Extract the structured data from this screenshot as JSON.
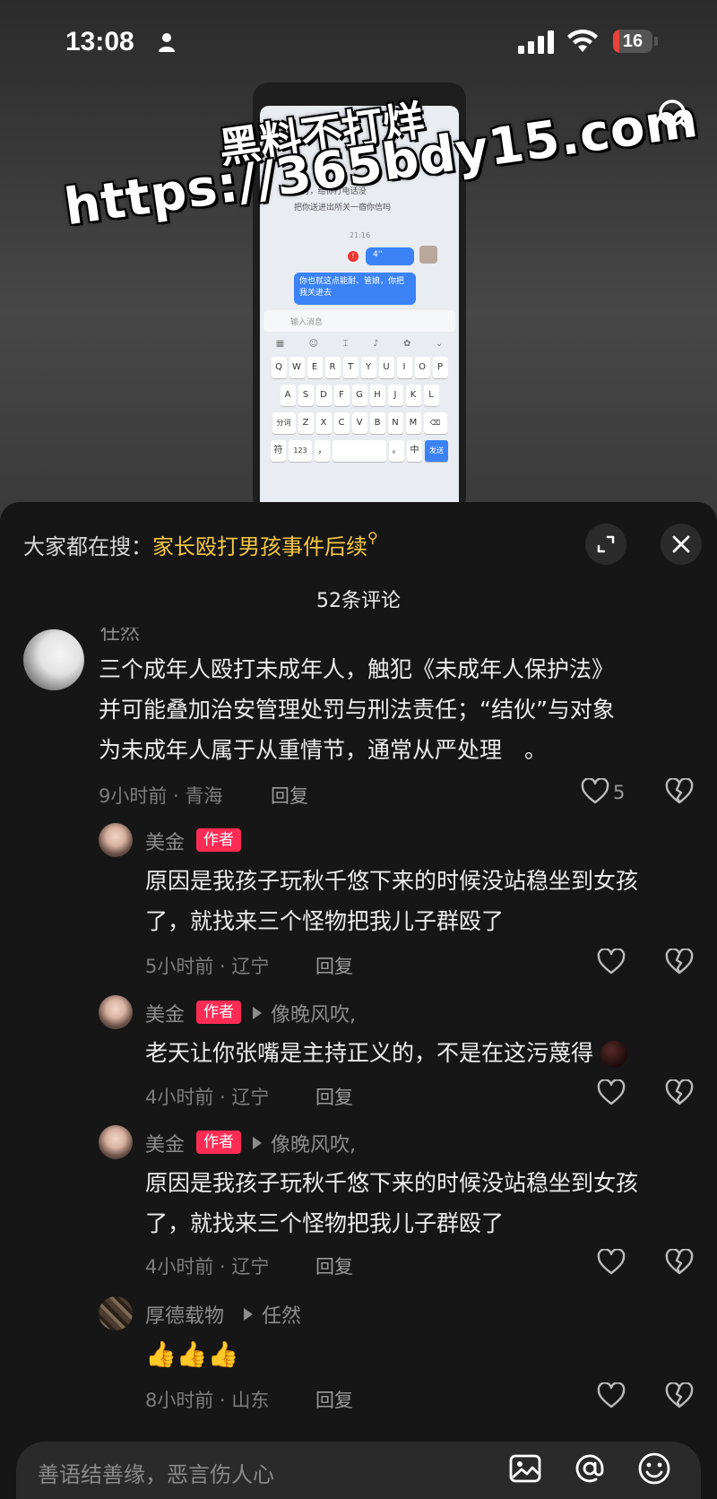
{
  "status_bar": {
    "time": "13:08",
    "battery": "16",
    "battery_level": 0.16,
    "colors": {
      "battery_low": "#e5433b"
    }
  },
  "video": {
    "watermark_line1": "黑料不打烊",
    "watermark_line2": "https://365bdy15.com",
    "phone_screen": {
      "line1": "...打，给你打电话没",
      "line2": "把你送进出所关一宿你信吗",
      "time": "21:16",
      "voice": "4''",
      "message": "你也就这点能耐、管娘，你把我关进去",
      "input_placeholder": "输入消息",
      "kb_row1": [
        "Q",
        "W",
        "E",
        "R",
        "T",
        "Y",
        "U",
        "I",
        "O",
        "P"
      ],
      "kb_row2": [
        "A",
        "S",
        "D",
        "F",
        "G",
        "H",
        "J",
        "K",
        "L"
      ],
      "kb_row3": [
        "分词",
        "Z",
        "X",
        "C",
        "V",
        "B",
        "N",
        "M",
        "⌫"
      ],
      "kb_row4": [
        "符",
        "123",
        "，",
        "",
        "。",
        "中",
        "发送"
      ]
    }
  },
  "panel": {
    "hot_search_prefix": "大家都在搜：",
    "hot_search_topic": "家长殴打男孩事件后续",
    "comment_count": "52条评论"
  },
  "comments": [
    {
      "username": "任然",
      "text_lines": [
        "三个成年人殴打未成年人，触犯《未成年人保护法》",
        "并可能叠加治安管理处罚与刑法责任；“结伙”与对象",
        "为未成年人属于从重情节，通常从严处理　。"
      ],
      "meta": "9小时前 · 青海",
      "reply": "回复",
      "likes": "5"
    },
    {
      "username": "美金",
      "tag": "作者",
      "text_lines": [
        "原因是我孩子玩秋千悠下来的时候没站稳坐到女孩",
        "了，就找来三个怪物把我儿子群殴了"
      ],
      "meta": "5小时前 · 辽宁",
      "reply": "回复"
    },
    {
      "username": "美金",
      "tag": "作者",
      "reply_to": "像晚风吹,",
      "text_lines": [
        "老天让你张嘴是主持正义的，不是在这污蔑得"
      ],
      "meta": "4小时前 · 辽宁",
      "reply": "回复"
    },
    {
      "username": "美金",
      "tag": "作者",
      "reply_to": "像晚风吹,",
      "text_lines": [
        "原因是我孩子玩秋千悠下来的时候没站稳坐到女孩",
        "了，就找来三个怪物把我儿子群殴了"
      ],
      "meta": "4小时前 · 辽宁",
      "reply": "回复"
    },
    {
      "username": "厚德载物",
      "reply_to": "任然",
      "emoji": "👍👍👍",
      "meta": "8小时前 · 山东",
      "reply": "回复"
    }
  ],
  "input": {
    "placeholder": "善语结善缘，恶言伤人心"
  }
}
